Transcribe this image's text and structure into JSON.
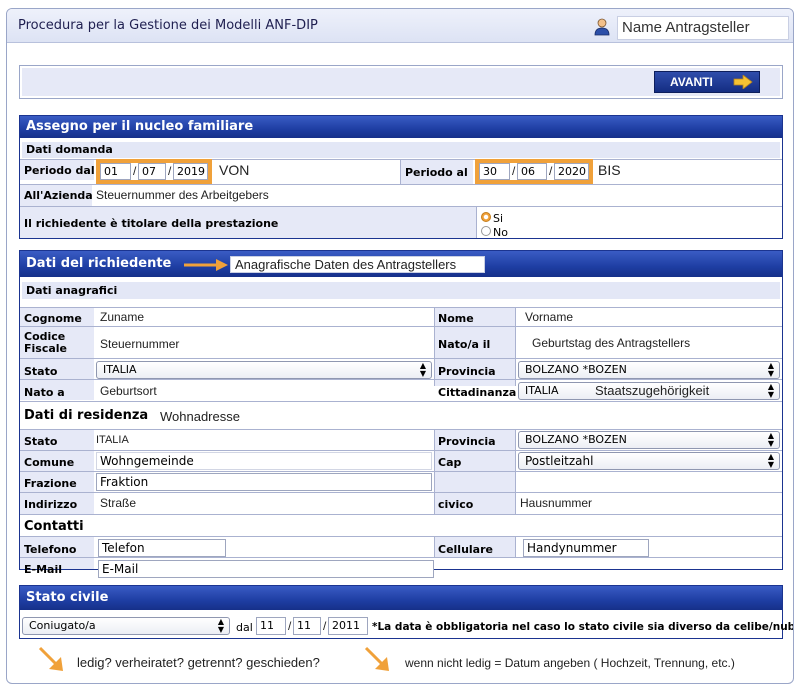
{
  "header": {
    "title": "Procedura per la Gestione dei Modelli ANF-DIP",
    "user_name": "Name Antragsteller"
  },
  "toolbar": {
    "avanti_label": "AVANTI"
  },
  "assegno": {
    "section_title": "Assegno per il nucleo familiare",
    "subheader": "Dati domanda",
    "periodo_dal_label": "Periodo dal",
    "dal_day": "01",
    "dal_month": "07",
    "dal_year": "2019",
    "von": "VON",
    "periodo_al_label": "Periodo al",
    "al_day": "30",
    "al_month": "06",
    "al_year": "2020",
    "bis": "BIS",
    "azienda_label": "All'Azienda",
    "azienda_value": "Steuernummer des Arbeitgebers",
    "titolare_label": "Il richiedente è titolare della prestazione",
    "radio_si": "Si",
    "radio_no": "No"
  },
  "richiedente": {
    "section_title": "Dati del richiedente",
    "annotation": "Anagrafische Daten des Antragstellers",
    "subheader": "Dati anagrafici",
    "cognome_label": "Cognome",
    "cognome_value": "Zuname",
    "nome_label": "Nome",
    "nome_value": "Vorname",
    "codice_label": "Codice Fiscale",
    "codice_value": "Steuernummer",
    "nato_il_label": "Nato/a il",
    "nato_il_value": "Geburtstag des Antragstellers",
    "stato_label": "Stato",
    "stato_value": "ITALIA",
    "provincia_label": "Provincia",
    "provincia_value": "BOLZANO *BOZEN",
    "nato_a_label": "Nato a",
    "nato_a_value": "Geburtsort",
    "cittadinanza_label": "Cittadinanza",
    "cittadinanza_value": "ITALIA",
    "cittadinanza_annot": "Staatszugehörigkeit",
    "residenza_header": "Dati di residenza",
    "residenza_annot": "Wohnadresse",
    "res_stato_label": "Stato",
    "res_stato_value": "ITALIA",
    "res_provincia_label": "Provincia",
    "res_provincia_value": "BOLZANO *BOZEN",
    "comune_label": "Comune",
    "comune_value": "Wohngemeinde",
    "cap_label": "Cap",
    "cap_value": "Postleitzahl",
    "frazione_label": "Frazione",
    "frazione_value": "Fraktion",
    "indirizzo_label": "Indirizzo",
    "indirizzo_value": "Straße",
    "civico_label": "civico",
    "civico_value": "Hausnummer",
    "contatti_header": "Contatti",
    "telefono_label": "Telefono",
    "telefono_value": "Telefon",
    "cellulare_label": "Cellulare",
    "cellulare_value": "Handynummer",
    "email_label": "E-Mail",
    "email_value": "E-Mail"
  },
  "civile": {
    "section_title": "Stato civile",
    "select_value": "Coniugato/a",
    "dal_label": "dal",
    "day": "11",
    "month": "11",
    "year": "2011",
    "note": "*La data è obbligatoria nel caso lo stato civile sia diverso da celibe/nubile"
  },
  "notes": {
    "left": "ledig? verheiratet? getrennt? geschieden?",
    "right": "wenn nicht ledig = Datum angeben ( Hochzeit, Trennung, etc.)"
  },
  "colors": {
    "accent_blue": "#1e3ea3",
    "highlight_orange": "#f0a13a"
  }
}
